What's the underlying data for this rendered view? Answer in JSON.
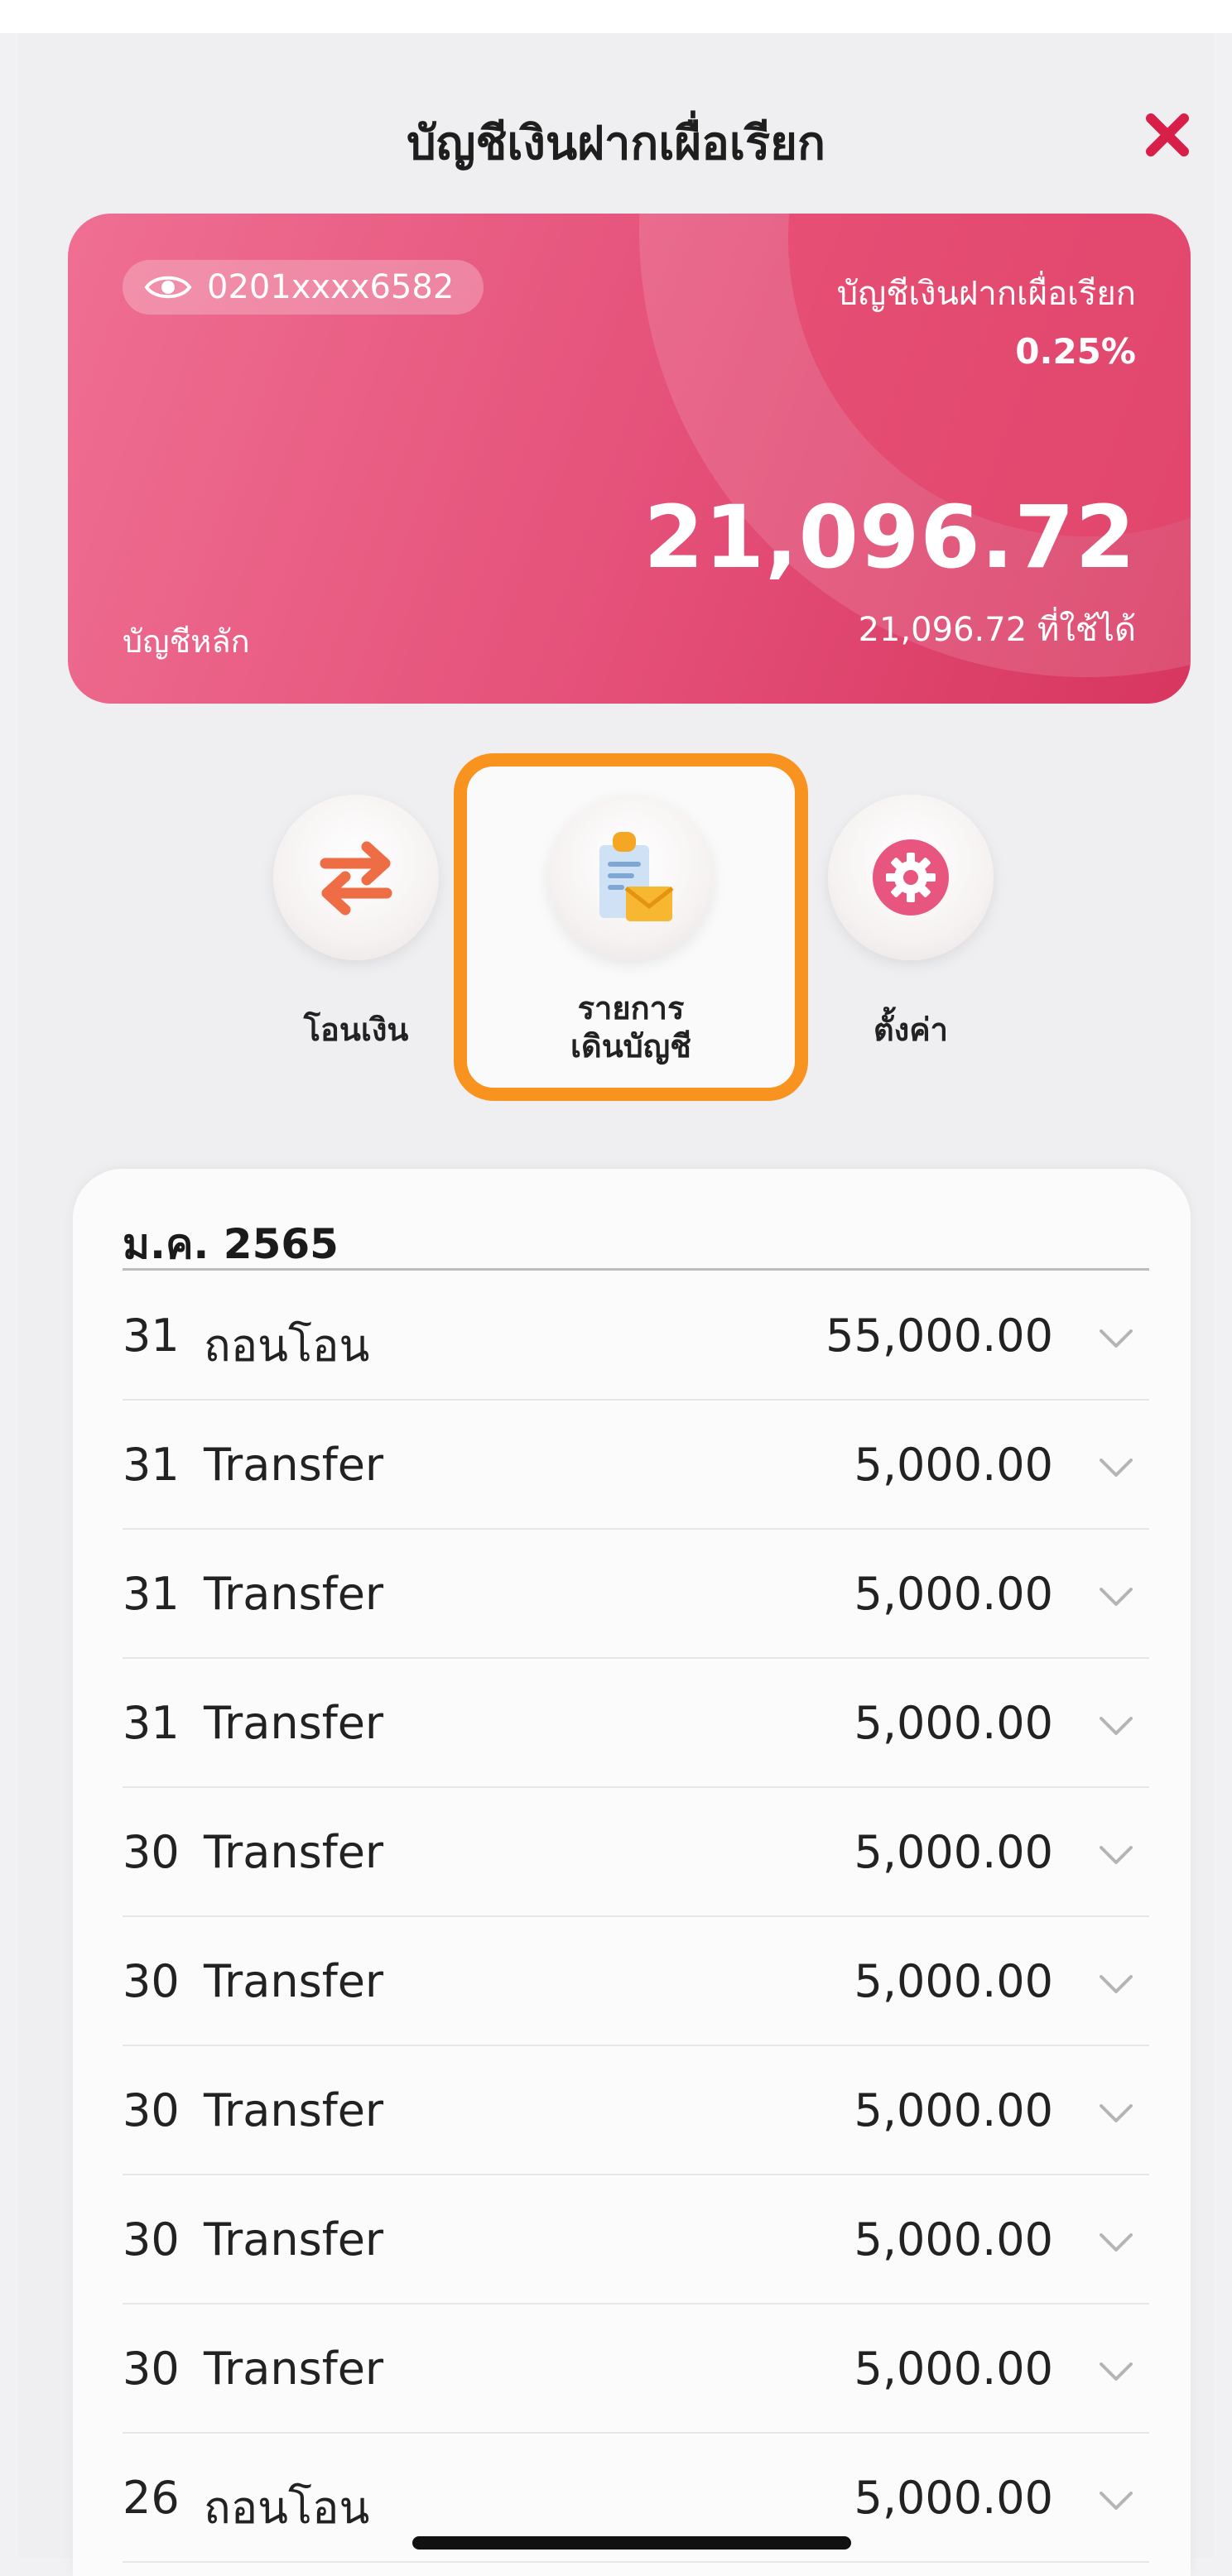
{
  "header": {
    "title": "บัญชีเงินฝากเผื่อเรียก"
  },
  "account_card": {
    "account_number": "0201xxxx6582",
    "account_type": "บัญชีเงินฝากเผื่อเรียก",
    "interest_rate": "0.25%",
    "balance": "21,096.72",
    "available": "21,096.72 ที่ใช้ได้",
    "label": "บัญชีหลัก"
  },
  "actions": [
    {
      "label": "โอนเงิน",
      "icon": "transfer-icon"
    },
    {
      "label_line1": "รายการ",
      "label_line2": "เดินบัญชี",
      "icon": "statement-icon"
    },
    {
      "label": "ตั้งค่า",
      "icon": "gear-icon"
    }
  ],
  "colors": {
    "card": "#e44f78",
    "highlight": "#f7931e",
    "close": "#d81f4a",
    "transfer_arrow": "#ee6d45"
  },
  "transactions": {
    "month": "ม.ค. 2565",
    "rows": [
      {
        "day": "31",
        "desc": "ถอนโอน",
        "amount": "55,000.00"
      },
      {
        "day": "31",
        "desc": "Transfer",
        "amount": "5,000.00"
      },
      {
        "day": "31",
        "desc": "Transfer",
        "amount": "5,000.00"
      },
      {
        "day": "31",
        "desc": "Transfer",
        "amount": "5,000.00"
      },
      {
        "day": "30",
        "desc": "Transfer",
        "amount": "5,000.00"
      },
      {
        "day": "30",
        "desc": "Transfer",
        "amount": "5,000.00"
      },
      {
        "day": "30",
        "desc": "Transfer",
        "amount": "5,000.00"
      },
      {
        "day": "30",
        "desc": "Transfer",
        "amount": "5,000.00"
      },
      {
        "day": "30",
        "desc": "Transfer",
        "amount": "5,000.00"
      },
      {
        "day": "26",
        "desc": "ถอนโอน",
        "amount": "5,000.00"
      }
    ]
  }
}
